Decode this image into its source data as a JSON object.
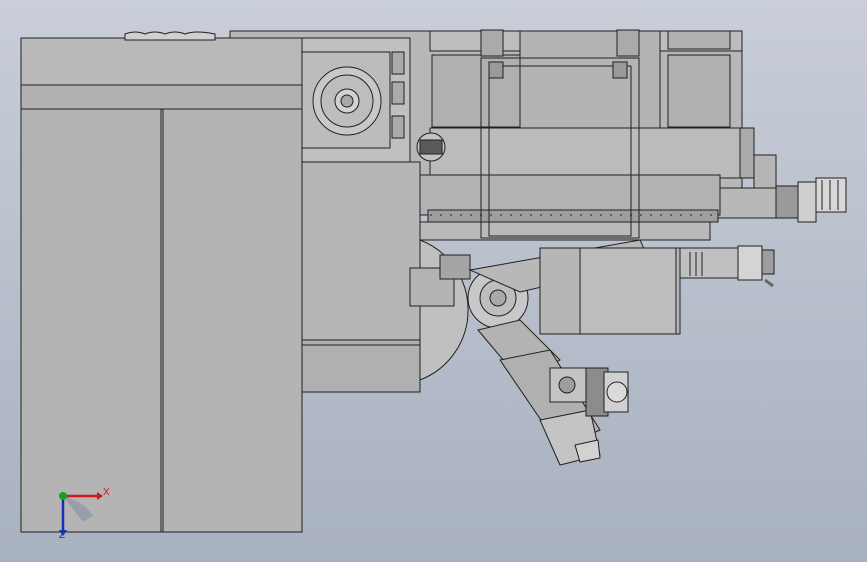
{
  "viewport": {
    "background_top": "#c7cdd7",
    "background_bottom": "#a9b2c1",
    "line_color": "#202020",
    "fill_light": "#b9b9b9",
    "fill_mid": "#a4a4a4",
    "fill_dark": "#8a8a8a"
  },
  "triad": {
    "x_label": "X",
    "z_label": "Z",
    "x_color": "#d01818",
    "y_color": "#18a018",
    "z_color": "#1830b0"
  }
}
